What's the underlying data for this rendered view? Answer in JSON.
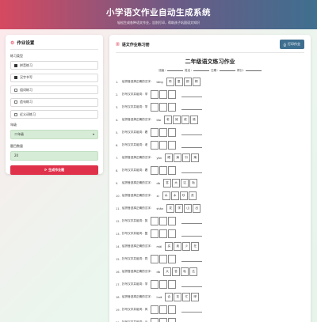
{
  "header": {
    "title": "小学语文作业自动生成系统",
    "subtitle": "轻松生成各种语文作业，告别打印，帮助孩子巩固语文知识"
  },
  "sidebar": {
    "title": "作业设置",
    "type_label": "练习类型",
    "types": [
      {
        "label": "拼音练习",
        "checked": true
      },
      {
        "label": "汉字书写",
        "checked": true
      },
      {
        "label": "组词练习",
        "checked": false
      },
      {
        "label": "造句练习",
        "checked": false
      },
      {
        "label": "近义词练习",
        "checked": false
      }
    ],
    "grade_label": "年级",
    "grade_value": "二年级",
    "count_label": "题目数量",
    "count_value": "20",
    "generate_label": "生成作业题"
  },
  "main": {
    "title": "语文作业练习册",
    "print_label": "打印作业",
    "sheet_title": "二年级语文练习作业",
    "field_name": "班级：",
    "field_class": "姓名：",
    "field_date": "日期：",
    "field_score": "得分：",
    "questions": [
      {
        "n": "1.",
        "text": "给拼音选择正确的汉字：",
        "py": "tóng",
        "opts": [
          "同",
          "童",
          "铜",
          "桐"
        ]
      },
      {
        "n": "2.",
        "text": "抄写汉字并组词：学",
        "py": "",
        "opts": []
      },
      {
        "n": "3.",
        "text": "抄写汉字并组词：学",
        "py": "",
        "opts": []
      },
      {
        "n": "4.",
        "text": "给拼音选择正确的汉字：",
        "py": "lǎo",
        "opts": [
          "老",
          "姥",
          "佬",
          "烙"
        ]
      },
      {
        "n": "5.",
        "text": "抄写汉字并组词：看",
        "py": "",
        "opts": []
      },
      {
        "n": "6.",
        "text": "抄写汉字并组词：老",
        "py": "",
        "opts": []
      },
      {
        "n": "7.",
        "text": "给拼音选择正确的汉字：",
        "py": "yǎn",
        "opts": [
          "眼",
          "演",
          "衍",
          "掩"
        ]
      },
      {
        "n": "8.",
        "text": "抄写汉字并组词：看",
        "py": "",
        "opts": []
      },
      {
        "n": "9.",
        "text": "给拼音选择正确的汉字：",
        "py": "dà",
        "opts": [
          "答",
          "大",
          "达",
          "哒"
        ]
      },
      {
        "n": "10.",
        "text": "给拼音选择正确的汉字：",
        "py": "xì",
        "opts": [
          "水",
          "木",
          "吵",
          "洗"
        ]
      },
      {
        "n": "11.",
        "text": "给拼音选择正确的汉字：",
        "py": "shān",
        "opts": [
          "发",
          "学",
          "山",
          "出"
        ]
      },
      {
        "n": "12.",
        "text": "抄写汉字并组词：剪",
        "py": "",
        "opts": []
      },
      {
        "n": "13.",
        "text": "抄写汉字并组词：复",
        "py": "",
        "opts": []
      },
      {
        "n": "14.",
        "text": "给拼音选择正确的汉字：",
        "py": "mǎi",
        "opts": [
          "买",
          "卖",
          "少",
          "在"
        ]
      },
      {
        "n": "15.",
        "text": "抄写汉字并组词：同",
        "py": "",
        "opts": []
      },
      {
        "n": "16.",
        "text": "给拼音选择正确的汉字：",
        "py": "dà",
        "opts": [
          "大",
          "答",
          "哒",
          "达"
        ]
      },
      {
        "n": "17.",
        "text": "抄写汉字并组词：学",
        "py": "",
        "opts": []
      },
      {
        "n": "18.",
        "text": "给拼音选择正确的汉字：",
        "py": "huā",
        "opts": [
          "合",
          "花",
          "忙",
          "哗"
        ]
      },
      {
        "n": "19.",
        "text": "抄写汉字并组词：风",
        "py": "",
        "opts": []
      },
      {
        "n": "20.",
        "text": "抄写汉字并组词：云",
        "py": "",
        "opts": []
      }
    ]
  },
  "icons": {
    "settings": "gear-icon",
    "book": "book-icon",
    "print": "printer-icon",
    "refresh": "refresh-icon"
  },
  "colors": {
    "accent": "#e0314b",
    "print_button": "#3f6f8f",
    "select_bg": "#d6ecd6"
  }
}
